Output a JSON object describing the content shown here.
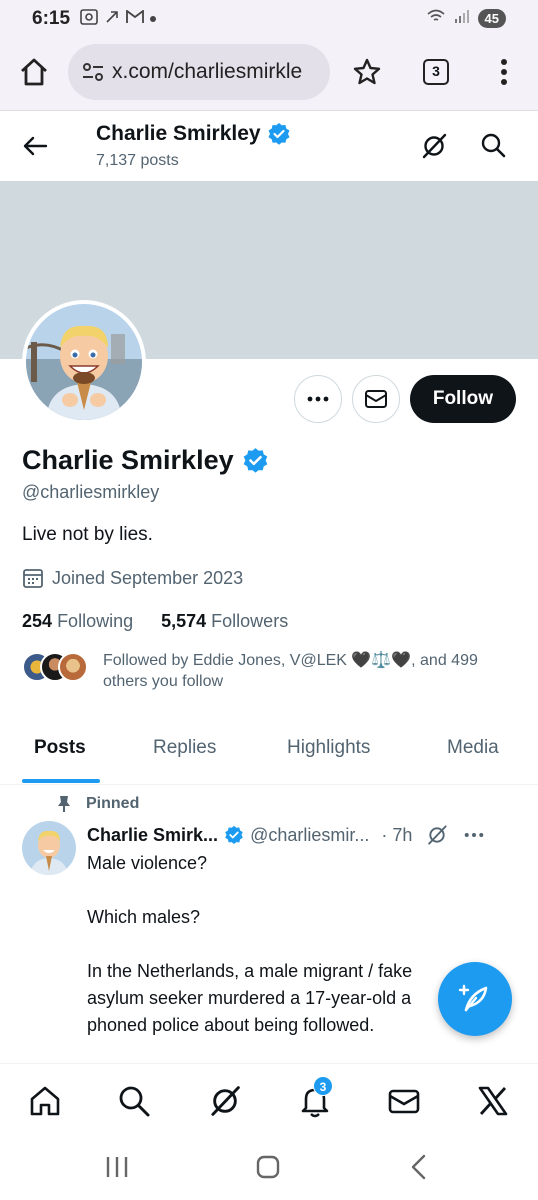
{
  "status_bar": {
    "time": "6:15",
    "battery": "45"
  },
  "browser": {
    "url": "x.com/charliesmirkle",
    "tab_count": "3"
  },
  "header": {
    "name": "Charlie Smirkley",
    "posts": "7,137 posts"
  },
  "profile": {
    "name": "Charlie Smirkley",
    "handle": "@charliesmirkley",
    "bio": "Live not by lies.",
    "joined": "Joined September 2023",
    "following_count": "254",
    "following_label": "Following",
    "followers_count": "5,574",
    "followers_label": "Followers",
    "followed_by": "Followed by Eddie Jones, V@LEK 🖤⚖️🖤, and 499 others you follow",
    "follow_label": "Follow"
  },
  "tabs": [
    "Posts",
    "Replies",
    "Highlights",
    "Media"
  ],
  "tweet": {
    "pinned_label": "Pinned",
    "name": "Charlie Smirk...",
    "handle": "@charliesmir...",
    "time": "· 7h",
    "paragraphs": [
      "Male violence?",
      "Which males?",
      "In the Netherlands, a male migrant / fake asylum seeker murdered a 17-year-old a phoned police about being followed."
    ]
  },
  "bottom_nav": {
    "notification_badge": "3"
  },
  "colors": {
    "accent": "#1d9bf0",
    "text": "#0f1419",
    "muted": "#536471",
    "banner": "#cfd9de"
  }
}
